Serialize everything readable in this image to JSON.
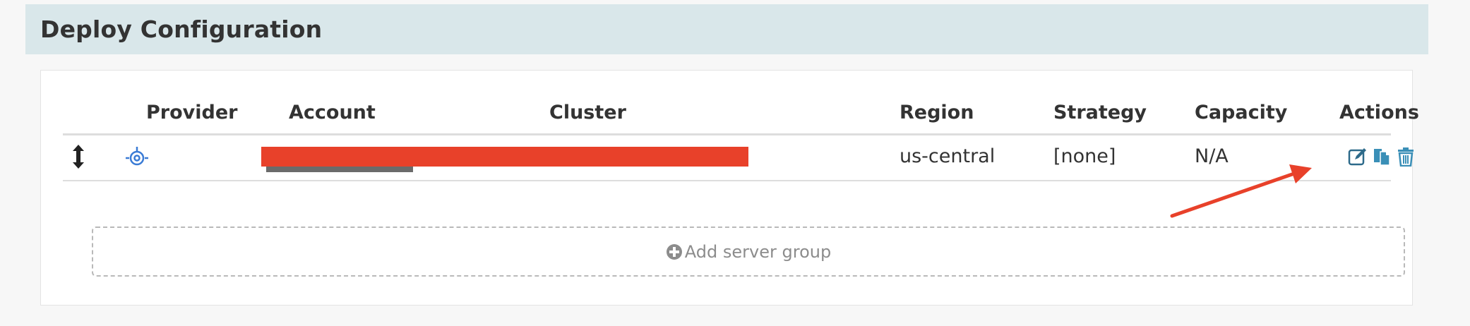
{
  "section": {
    "title": "Deploy Configuration"
  },
  "table": {
    "headers": {
      "provider": "Provider",
      "account": "Account",
      "cluster": "Cluster",
      "region": "Region",
      "strategy": "Strategy",
      "capacity": "Capacity",
      "actions": "Actions"
    },
    "rows": [
      {
        "provider_icon": "gce-provider-icon",
        "account": "",
        "cluster": "",
        "region": "us-central",
        "strategy": "[none]",
        "capacity": "N/A",
        "actions": [
          "edit-icon",
          "clone-icon",
          "delete-icon"
        ]
      }
    ]
  },
  "add_server_group": {
    "label": "Add server group",
    "icon": "plus-circle-icon"
  },
  "colors": {
    "header_band": "#d9e7ea",
    "action_icon": "#3a8fb7",
    "annotation": "#e8412a",
    "redaction": "#e8412a"
  }
}
